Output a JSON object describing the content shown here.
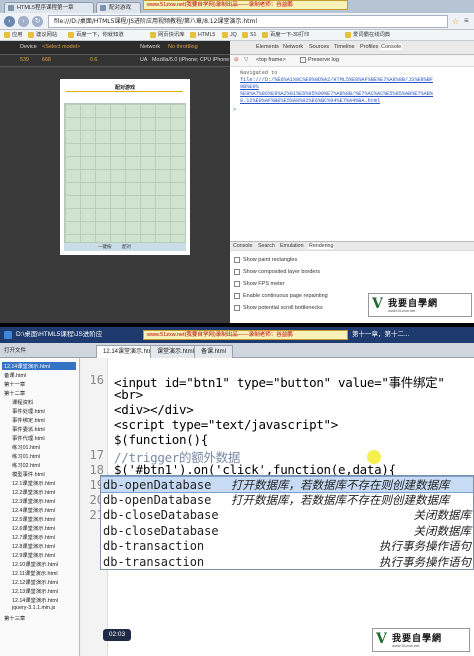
{
  "browser": {
    "tabs": [
      "HTML5程序课程第一章",
      "配对游戏"
    ],
    "promo": "www.51zxw.net(我要自学网)录制出品——录制老师：谷益鹏",
    "address": "file:///D:/桌面/HTML5课程/JS进阶应用视频教程/第八章/8.12课堂演示.html",
    "bookmarks": [
      "应用",
      "建议网站",
      "百度一下，你就知道",
      "网页快讯库",
      "HTML5",
      "JQ",
      "S1",
      "百度一下-30打印",
      "爱词霸在线词典"
    ]
  },
  "emulator": {
    "device_label": "Device",
    "device_value": "<Select model>",
    "network_label": "Network",
    "network_value": "No throttling",
    "width_value": "539",
    "height_value": "668",
    "scale": "0.6",
    "ua_label": "UA",
    "ua_value": "Mozilla/5.0 (iPhone; CPU iPhone OS",
    "page_heading": "配对游戏",
    "footer_left": "一键按",
    "footer_right": "配对"
  },
  "devtools": {
    "tabs": [
      "Elements",
      "Network",
      "Sources",
      "Timeline",
      "Profiles",
      "Console"
    ],
    "frame": "<top frame>",
    "preserve_log": "Preserve log",
    "navigated_to": "Navigated to",
    "link1": "file:///D:/%E6%A1%8C%E9%9D%A2/HTML5%E8%AF%BE%E7%A8%8B/JS%E8%BF",
    "link1b": "9B%E9%",
    "link2": "%E8%A7%86%E9%A2%91%E6%95%99%E7%A8%8B/%E7%AC%AC%E5%85%AB%E7%AB%",
    "link2b": "8.12%E8%AF%BE%E5%A0%82%E6%BC%94%E7%A4%BA.html",
    "drawer_tabs": [
      "Console",
      "Search",
      "Emulation",
      "Rendering"
    ],
    "options": [
      "Show paint rectangles",
      "Show composited layer borders",
      "Show FPS meter",
      "Enable continuous page repainting",
      "Show potential scroll bottlenecks"
    ]
  },
  "logo": {
    "text": "我要自學網",
    "url": "www.51zxw.net"
  },
  "ide": {
    "title": "D:\\桌面\\HTML5课程\\JS进阶应",
    "title_right": "第十一章，第十二...",
    "tabs": [
      "12.14课堂演示.html",
      "课堂演示.html",
      "备课.html"
    ],
    "sidebar_title": "打开文件",
    "files": [
      "12.14课堂演示.html",
      "备课.html",
      "第十一章",
      "第十二章",
      "课程资料",
      "事件处理.html",
      "事件绑定.html",
      "事件委派.html",
      "事件代理.html",
      "练习01.html",
      "练习01.html",
      "练习02.html",
      "模型事件.html",
      "12.1课堂演示.html",
      "12.2课堂演示.html",
      "12.3课堂演示.html",
      "12.4课堂演示.html",
      "12.5课堂演示.html",
      "12.6课堂演示.html",
      "12.7课堂演示.html",
      "12.8课堂演示.html",
      "12.9课堂演示.html",
      "12.10课堂演示.html",
      "12.11课堂演示.html",
      "12.12课堂演示.html",
      "12.13课堂演示.html",
      "12.14课堂演示.html",
      "jquery-3.1.1.min.js",
      "第十三章"
    ],
    "line_numbers": [
      "16",
      "17",
      "18",
      "19",
      "20",
      "21"
    ],
    "code_lines": [
      "<input id=\"btn1\" type=\"button\" value=\"事件绑定\"",
      "<br>",
      "<div></div>",
      "<script type=\"text/javascript\">",
      "    $(function(){",
      "      //trigger的额外数据",
      "        $('#btn1').on('click',function(e,data){"
    ],
    "autocomplete": [
      {
        "name": "db-openDatabase",
        "desc": "打开数据库，若数据库不存在则创建数据库"
      },
      {
        "name": "db-openDatabase",
        "desc": "打开数据库，若数据库不存在则创建数据库"
      },
      {
        "name": "db-closeDatabase",
        "desc": "关闭数据库"
      },
      {
        "name": "db-closeDatabase",
        "desc": "关闭数据库"
      },
      {
        "name": "db-transaction",
        "desc": "执行事务操作语句"
      },
      {
        "name": "db-transaction",
        "desc": "执行事务操作语句"
      }
    ],
    "timer": "02:03"
  }
}
